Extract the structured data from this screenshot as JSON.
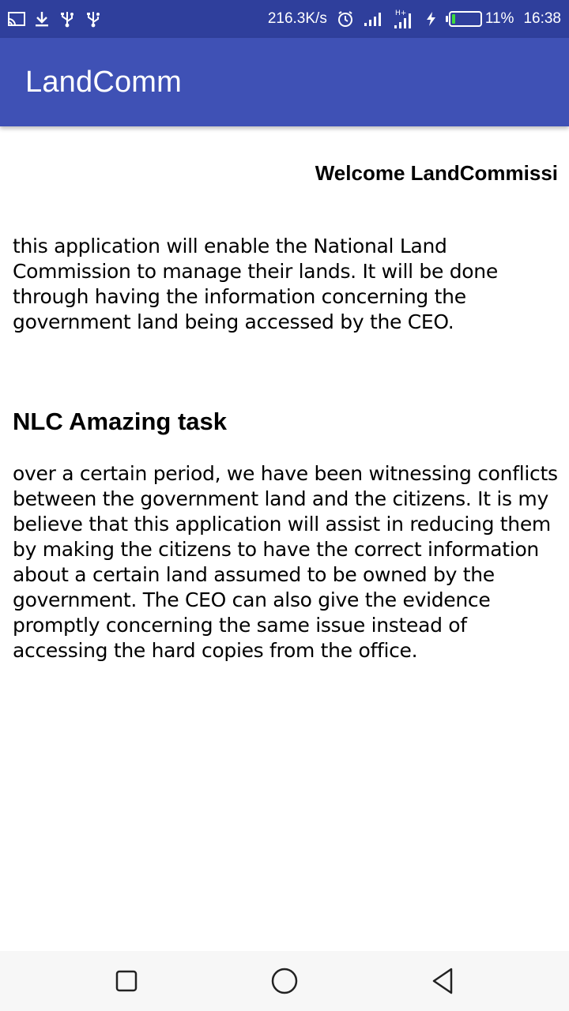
{
  "status_bar": {
    "net_speed": "216.3K/s",
    "battery_percent": "11%",
    "time": "16:38",
    "network_type": "H+",
    "battery_level": 0.11,
    "icons": [
      "cast-icon",
      "download-icon",
      "usb-icon",
      "usb-icon",
      "alarm-icon",
      "signal-icon",
      "signal-icon",
      "charging-icon",
      "battery-icon"
    ]
  },
  "app_bar": {
    "title": "LandComm",
    "color": "#3f51b5"
  },
  "content": {
    "welcome": "Welcome LandCommissi",
    "intro": "this application will enable the National Land Commission to manage their lands. It will be done through having the information concerning the government land being accessed by the CEO.",
    "heading": "NLC Amazing task",
    "body": "over a certain period, we have been witnessing conflicts between the government land and the citizens. It is my believe that this application will assist in reducing them by making the citizens to have the correct information about a certain land assumed to be owned by the government. The CEO can also give the evidence promptly concerning the same issue instead of accessing the hard copies from the office."
  },
  "nav_bar": {
    "icons": [
      "recent-apps-icon",
      "home-icon",
      "back-icon"
    ]
  }
}
